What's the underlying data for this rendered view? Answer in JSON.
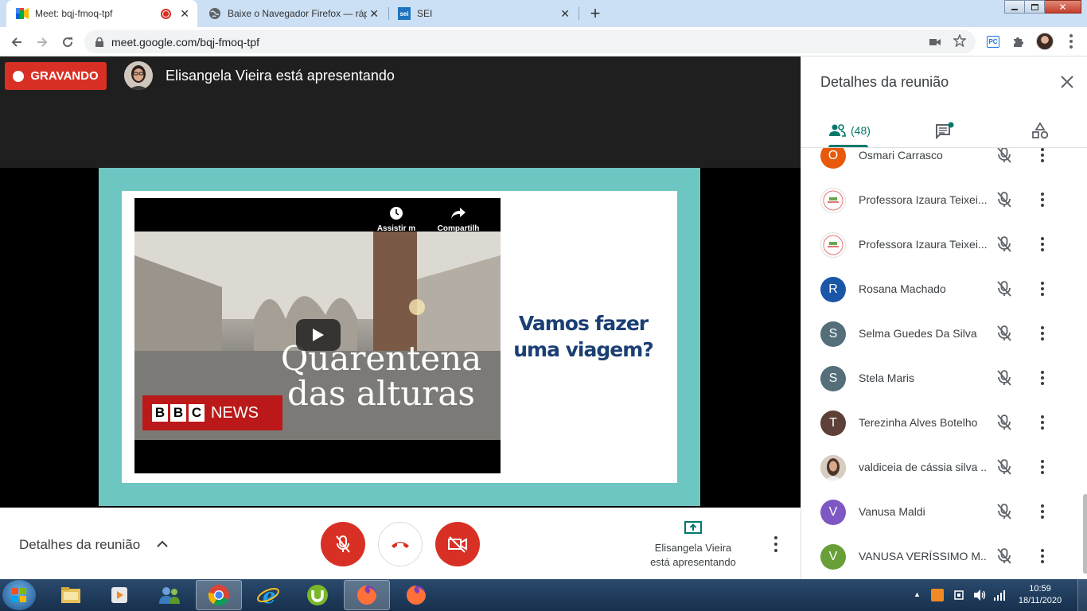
{
  "browser": {
    "tabs": [
      {
        "title": "Meet: bqj-fmoq-tpf",
        "active": true,
        "recording": true
      },
      {
        "title": "Baixe o Navegador Firefox — ráp",
        "active": false
      },
      {
        "title": "SEI",
        "active": false
      }
    ],
    "url": "meet.google.com/bqj-fmoq-tpf",
    "favicon_sei": "sei",
    "ext_pc": "PC"
  },
  "meet": {
    "recording_label": "GRAVANDO",
    "presenting_text": "Elisangela Vieira está apresentando",
    "slide": {
      "video_overlay": {
        "watch_later": "Assistir m",
        "share": "Compartilh"
      },
      "video_title_line1": "Quarentena",
      "video_title_line2": "das alturas",
      "bbc": [
        "B",
        "B",
        "C"
      ],
      "news": "NEWS",
      "question": "Vamos fazer uma viagem?"
    },
    "bottom": {
      "details_label": "Detalhes da reunião",
      "present_status_line1": "Elisangela Vieira",
      "present_status_line2": "está apresentando"
    }
  },
  "panel": {
    "title": "Detalhes da reunião",
    "people_count": "(48)",
    "accent_color": "#00796b",
    "participants": [
      {
        "name": "Osmari Carrasco",
        "initial": "O",
        "color": "#e8590c",
        "type": "letter"
      },
      {
        "name": "Professora Izaura Teixei...",
        "initial": "",
        "color": "#ffffff",
        "type": "logo"
      },
      {
        "name": "Professora Izaura Teixei...",
        "initial": "",
        "color": "#ffffff",
        "type": "logo"
      },
      {
        "name": "Rosana Machado",
        "initial": "R",
        "color": "#1a56a6",
        "type": "letter"
      },
      {
        "name": "Selma Guedes Da Silva",
        "initial": "S",
        "color": "#546e7a",
        "type": "letter"
      },
      {
        "name": "Stela Maris",
        "initial": "S",
        "color": "#546e7a",
        "type": "letter"
      },
      {
        "name": "Terezinha Alves Botelho",
        "initial": "T",
        "color": "#5d4037",
        "type": "letter"
      },
      {
        "name": "valdiceia de cássia silva ...",
        "initial": "",
        "color": "#c8b4a0",
        "type": "photo"
      },
      {
        "name": "Vanusa Maldi",
        "initial": "V",
        "color": "#7e57c2",
        "type": "letter"
      },
      {
        "name": "VANUSA VERÍSSIMO M...",
        "initial": "V",
        "color": "#689f38",
        "type": "letter"
      }
    ]
  },
  "taskbar": {
    "time": "10:59",
    "date": "18/11/2020"
  }
}
